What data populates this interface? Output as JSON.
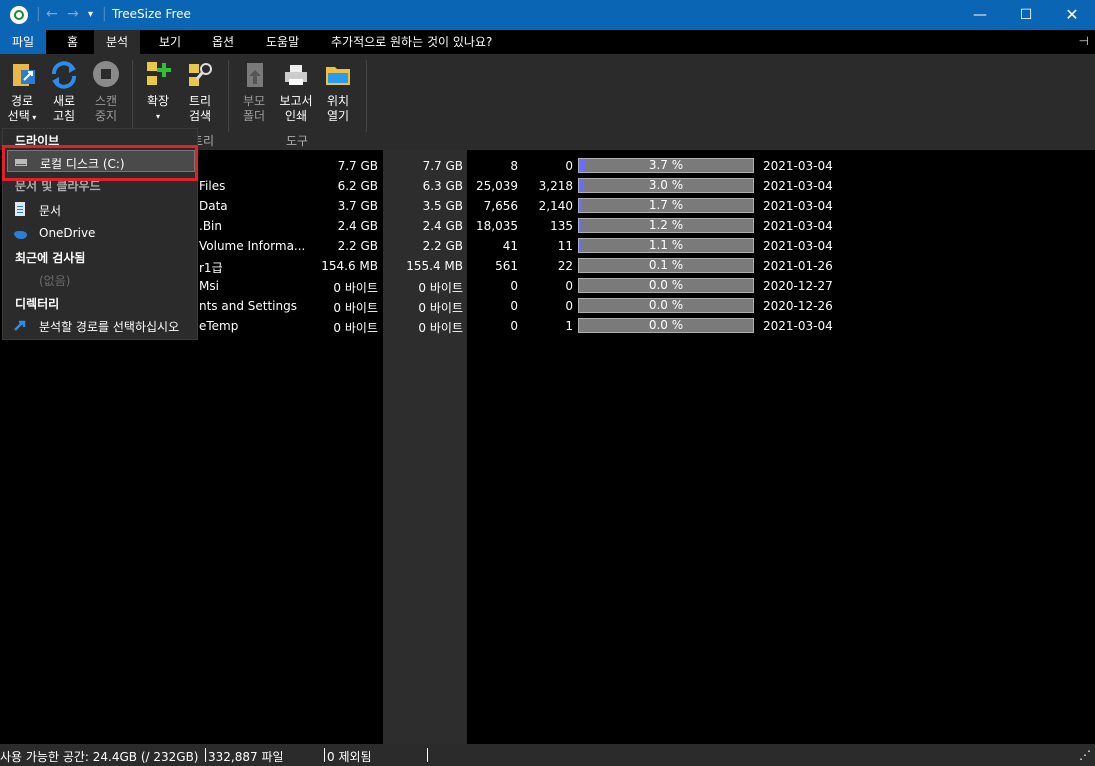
{
  "window": {
    "title": "TreeSize Free",
    "controls": [
      "minimize",
      "maximize",
      "close"
    ]
  },
  "menubar": {
    "tabs": [
      {
        "label": "파일"
      },
      {
        "label": "홈"
      },
      {
        "label": "분석"
      },
      {
        "label": "보기"
      },
      {
        "label": "옵션"
      },
      {
        "label": "도움말"
      },
      {
        "label": "추가적으로 원하는 것이 있나요?"
      }
    ]
  },
  "ribbon": {
    "path_select": "경로\n선택",
    "path_select_l1": "경로",
    "path_select_l2": "선택",
    "refresh_l1": "새로",
    "refresh_l2": "고침",
    "stop_l1": "스캔",
    "stop_l2": "중지",
    "expand_l1": "확장",
    "tree_l1": "트리",
    "tree_l2": "검색",
    "tree_group": "트리",
    "parent_l1": "부모",
    "parent_l2": "폴더",
    "print_l1": "보고서",
    "print_l2": "인쇄",
    "open_l1": "위치",
    "open_l2": "열기",
    "tools_group": "도구"
  },
  "rows": [
    {
      "name": "",
      "size": "7.7 GB",
      "alloc": "7.7 GB",
      "files": "8",
      "folders": "0",
      "pct": "3.7 %",
      "pct_value": 3.7,
      "date": "2021-03-04"
    },
    {
      "name": "Files",
      "size": "6.2 GB",
      "alloc": "6.3 GB",
      "files": "25,039",
      "folders": "3,218",
      "pct": "3.0 %",
      "pct_value": 3.0,
      "date": "2021-03-04"
    },
    {
      "name": "Data",
      "size": "3.7 GB",
      "alloc": "3.5 GB",
      "files": "7,656",
      "folders": "2,140",
      "pct": "1.7 %",
      "pct_value": 1.7,
      "date": "2021-03-04"
    },
    {
      "name": ".Bin",
      "size": "2.4 GB",
      "alloc": "2.4 GB",
      "files": "18,035",
      "folders": "135",
      "pct": "1.2 %",
      "pct_value": 1.2,
      "date": "2021-03-04"
    },
    {
      "name": "Volume Informa...",
      "size": "2.2 GB",
      "alloc": "2.2 GB",
      "files": "41",
      "folders": "11",
      "pct": "1.1 %",
      "pct_value": 1.1,
      "date": "2021-03-04"
    },
    {
      "name": "r1급",
      "size": "154.6 MB",
      "alloc": "155.4 MB",
      "files": "561",
      "folders": "22",
      "pct": "0.1 %",
      "pct_value": 0.1,
      "date": "2021-01-26"
    },
    {
      "name": "Msi",
      "size": "0 바이트",
      "alloc": "0 바이트",
      "files": "0",
      "folders": "0",
      "pct": "0.0 %",
      "pct_value": 0.0,
      "date": "2020-12-27"
    },
    {
      "name": "nts and Settings",
      "size": "0 바이트",
      "alloc": "0 바이트",
      "files": "0",
      "folders": "0",
      "pct": "0.0 %",
      "pct_value": 0.0,
      "date": "2020-12-26"
    },
    {
      "name": "eTemp",
      "size": "0 바이트",
      "alloc": "0 바이트",
      "files": "0",
      "folders": "1",
      "pct": "0.0 %",
      "pct_value": 0.0,
      "date": "2021-03-04"
    }
  ],
  "dropdown": {
    "drives_header": "드라이브",
    "local_disk": "로컬 디스크 (C:)",
    "docs_header": "문서 및 클라우드",
    "documents": "문서",
    "onedrive": "OneDrive",
    "recent_header": "최근에 검사됨",
    "recent_empty": "(없음)",
    "directory_header": "디렉터리",
    "choose_path": "분석할 경로를 선택하십시오"
  },
  "status": {
    "free_space": "사용 가능한 공간: 24.4GB  (/ 232GB)",
    "files": "332,887 파일",
    "excluded": "0 제외됨"
  },
  "colors": {
    "titlebar": "#0a66b5",
    "bar_fill": "#6b6bff",
    "highlight": "#e0202a"
  }
}
